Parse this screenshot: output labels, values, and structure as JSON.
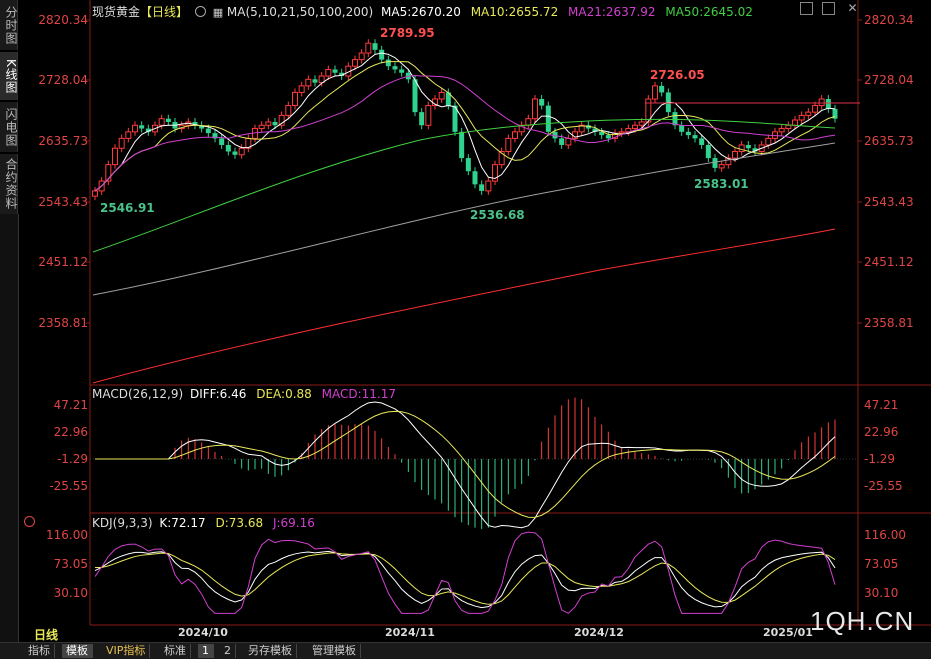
{
  "sidebar": {
    "tabs": [
      {
        "label": "分时图"
      },
      {
        "label": "K线图"
      },
      {
        "label": "闪电图"
      },
      {
        "label": "合约资料"
      }
    ]
  },
  "main_chart": {
    "title": "现货黄金",
    "period": "【日线】",
    "ma_label": "MA(5,10,21,50,100,200)",
    "ma5": "MA5:2670.20",
    "ma10": "MA10:2655.72",
    "ma21": "MA21:2637.92",
    "ma50": "MA50:2645.02",
    "y_ticks": [
      "2820.34",
      "2728.04",
      "2635.73",
      "2543.43",
      "2451.12",
      "2358.81"
    ],
    "annotations": {
      "high": "2789.95",
      "low1": "2546.91",
      "low2": "2536.68",
      "high2": "2726.05",
      "low3": "2583.01"
    },
    "colors": {
      "up": "#ff3b3b",
      "down": "#2fd28f",
      "ma5": "#ffffff",
      "ma10": "#e8e85a",
      "ma21": "#d040d0",
      "ma50": "#40d040",
      "ma100": "#a0a0a0",
      "ma200": "#ff3030"
    }
  },
  "macd": {
    "label": "MACD(26,12,9)",
    "diff": "DIFF:6.46",
    "dea": "DEA:0.88",
    "macd": "MACD:11.17",
    "y_ticks": [
      "47.21",
      "22.96",
      "-1.29",
      "-25.55"
    ]
  },
  "kdj": {
    "label": "KDJ(9,3,3)",
    "k": "K:72.17",
    "d": "D:73.68",
    "j": "J:69.16",
    "y_ticks": [
      "116.00",
      "73.05",
      "30.10"
    ]
  },
  "x_axis": {
    "period_label": "日线",
    "dates": [
      "2024/10",
      "2024/11",
      "2024/12",
      "2025/01"
    ]
  },
  "watermark": "1QH.CN",
  "bottom_bar": {
    "items": [
      "指标",
      "模板",
      "VIP指标",
      "标准",
      "1",
      "2",
      "另存模板",
      "管理模板"
    ]
  }
}
